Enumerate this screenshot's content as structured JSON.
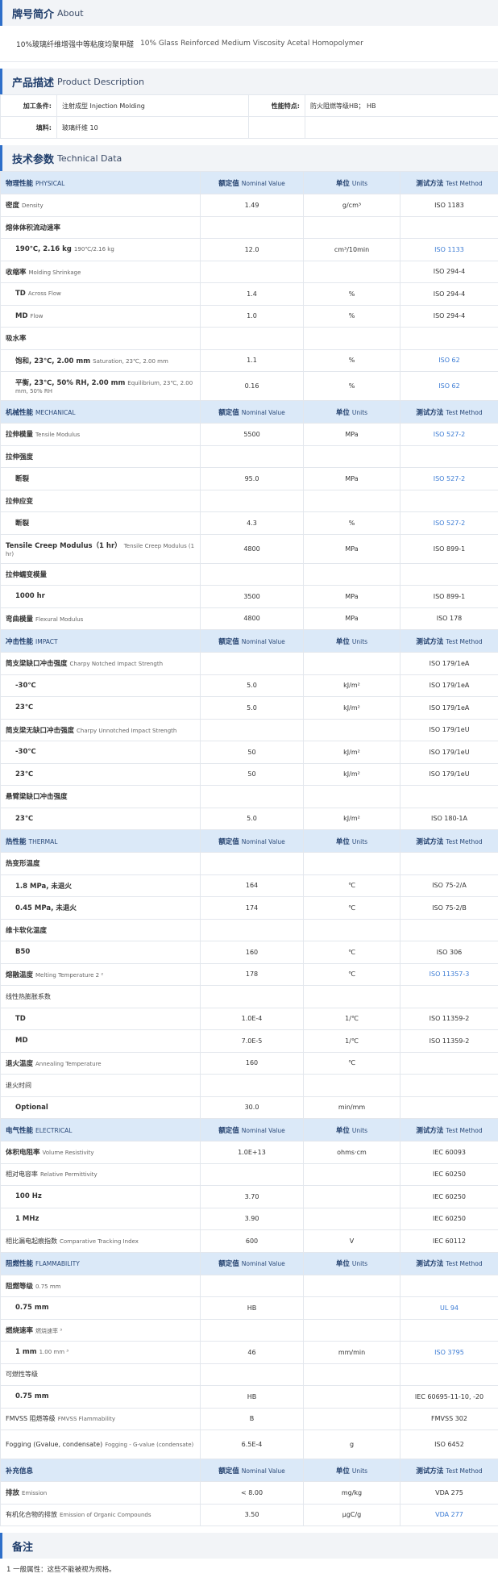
{
  "about": {
    "title_zh": "牌号简介",
    "title_en": "About",
    "text_zh": "10%玻璃纤维增强中等粘度均聚甲醛",
    "text_en": "10% Glass Reinforced Medium Viscosity Acetal Homopolymer"
  },
  "product": {
    "title_zh": "产品描述",
    "title_en": "Product Description",
    "rows": [
      {
        "label1": "加工条件:",
        "value1": "注射成型 Injection Molding",
        "label2": "性能特点:",
        "value2": "防火阻燃等级HB； HB"
      },
      {
        "label1": "填料:",
        "value1": "玻璃纤维 10",
        "label2": "",
        "value2": ""
      }
    ]
  },
  "tech": {
    "title_zh": "技术参数",
    "title_en": "Technical Data",
    "header_labels": {
      "nominal_zh": "额定值",
      "nominal_en": "Nominal Value",
      "units_zh": "单位",
      "units_en": "Units",
      "method_zh": "测试方法",
      "method_en": "Test Method"
    },
    "rows": [
      {
        "type": "hdr",
        "zh": "物理性能",
        "en": "PHYSICAL"
      },
      {
        "zh": "密度",
        "en": "Density",
        "value": "1.49",
        "unit": "g/cm³",
        "method": "ISO 1183"
      },
      {
        "zh": "熔体体积流动速率",
        "en": "熔体体积流动速率",
        "value": "",
        "unit": "",
        "method": ""
      },
      {
        "zh": "190℃, 2.16 kg",
        "en": "190℃/2.16 kg",
        "value": "12.0",
        "unit": "cm³/10min",
        "method": "ISO 1133",
        "ind": true,
        "link": true
      },
      {
        "zh": "收缩率",
        "en": "Molding Shrinkage",
        "value": "",
        "unit": "",
        "method": "ISO 294-4"
      },
      {
        "zh": "TD",
        "en": "Across Flow",
        "value": "1.4",
        "unit": "%",
        "method": "ISO 294-4",
        "ind": true
      },
      {
        "zh": "MD",
        "en": "Flow",
        "value": "1.0",
        "unit": "%",
        "method": "ISO 294-4",
        "ind": true
      },
      {
        "zh": "吸水率",
        "en": "吸水率",
        "value": "",
        "unit": "",
        "method": ""
      },
      {
        "zh": "饱和, 23℃, 2.00 mm",
        "en": "Saturation, 23℃, 2.00 mm",
        "value": "1.1",
        "unit": "%",
        "method": "ISO 62",
        "ind": true,
        "link": true
      },
      {
        "zh": "平衡, 23℃, 50% RH, 2.00 mm",
        "en": "Equilibrium, 23℃, 2.00 mm, 50% RH",
        "value": "0.16",
        "unit": "%",
        "method": "ISO 62",
        "ind": true,
        "link": true,
        "tall": true
      },
      {
        "type": "hdr",
        "zh": "机械性能",
        "en": "MECHANICAL"
      },
      {
        "zh": "拉伸模量",
        "en": "Tensile Modulus",
        "value": "5500",
        "unit": "MPa",
        "method": "ISO 527-2",
        "link": true
      },
      {
        "zh": "拉伸强度",
        "en": "拉伸强度",
        "value": "",
        "unit": "",
        "method": ""
      },
      {
        "zh": "断裂",
        "en": "断裂",
        "value": "95.0",
        "unit": "MPa",
        "method": "ISO 527-2",
        "ind": true,
        "link": true
      },
      {
        "zh": "拉伸应变",
        "en": "拉伸应变",
        "value": "",
        "unit": "",
        "method": ""
      },
      {
        "zh": "断裂",
        "en": "断裂",
        "value": "4.3",
        "unit": "%",
        "method": "ISO 527-2",
        "ind": true,
        "link": true
      },
      {
        "zh": "Tensile Creep Modulus（1 hr）",
        "en": "Tensile Creep Modulus (1 hr)",
        "value": "4800",
        "unit": "MPa",
        "method": "ISO 899-1",
        "tall": true
      },
      {
        "zh": "拉伸蠕变模量",
        "en": "拉伸蠕变模量",
        "value": "",
        "unit": "",
        "method": ""
      },
      {
        "zh": "1000 hr",
        "en": "1000 hr",
        "value": "3500",
        "unit": "MPa",
        "method": "ISO 899-1",
        "ind": true
      },
      {
        "zh": "弯曲模量",
        "en": "Flexural Modulus",
        "value": "4800",
        "unit": "MPa",
        "method": "ISO 178"
      },
      {
        "type": "hdr",
        "zh": "冲击性能",
        "en": "IMPACT"
      },
      {
        "zh": "简支梁缺口冲击强度",
        "en": "Charpy Notched Impact Strength",
        "value": "",
        "unit": "",
        "method": "ISO 179/1eA"
      },
      {
        "zh": "-30℃",
        "en": "-30℃",
        "value": "5.0",
        "unit": "kJ/m²",
        "method": "ISO 179/1eA",
        "ind": true
      },
      {
        "zh": "23℃",
        "en": "23℃",
        "value": "5.0",
        "unit": "kJ/m²",
        "method": "ISO 179/1eA",
        "ind": true
      },
      {
        "zh": "简支梁无缺口冲击强度",
        "en": "Charpy Unnotched Impact Strength",
        "value": "",
        "unit": "",
        "method": "ISO 179/1eU"
      },
      {
        "zh": "-30℃",
        "en": "-30℃",
        "value": "50",
        "unit": "kJ/m²",
        "method": "ISO 179/1eU",
        "ind": true
      },
      {
        "zh": "23℃",
        "en": "23℃",
        "value": "50",
        "unit": "kJ/m²",
        "method": "ISO 179/1eU",
        "ind": true
      },
      {
        "zh": "悬臂梁缺口冲击强度",
        "en": "悬臂梁缺口冲击强度",
        "value": "",
        "unit": "",
        "method": ""
      },
      {
        "zh": "23℃",
        "en": "23℃",
        "value": "5.0",
        "unit": "kJ/m²",
        "method": "ISO 180-1A",
        "ind": true
      },
      {
        "type": "hdr",
        "zh": "热性能",
        "en": "THERMAL"
      },
      {
        "zh": "热变形温度",
        "en": "热变形温度",
        "value": "",
        "unit": "",
        "method": ""
      },
      {
        "zh": "1.8 MPa, 未退火",
        "en": "1.8 MPa, 未退火",
        "value": "164",
        "unit": "℃",
        "method": "ISO 75-2/A",
        "ind": true
      },
      {
        "zh": "0.45 MPa, 未退火",
        "en": "0.45 MPa, 未退火",
        "value": "174",
        "unit": "℃",
        "method": "ISO 75-2/B",
        "ind": true
      },
      {
        "zh": "维卡软化温度",
        "en": "维卡软化温度",
        "value": "",
        "unit": "",
        "method": ""
      },
      {
        "zh": "B50",
        "en": "B50",
        "value": "160",
        "unit": "℃",
        "method": "ISO 306",
        "ind": true
      },
      {
        "zh": "熔融温度",
        "en": "Melting Temperature 2 ²",
        "value": "178",
        "unit": "℃",
        "method": "ISO 11357-3",
        "link": true
      },
      {
        "zh": "线性热膨胀系数",
        "en": "线性热膨胀系数",
        "value": "",
        "unit": "",
        "method": "",
        "plain": true
      },
      {
        "zh": "TD",
        "en": "TD",
        "value": "1.0E-4",
        "unit": "1/℃",
        "method": "ISO 11359-2",
        "ind": true
      },
      {
        "zh": "MD",
        "en": "MD",
        "value": "7.0E-5",
        "unit": "1/℃",
        "method": "ISO 11359-2",
        "ind": true
      },
      {
        "zh": "退火温度",
        "en": "Annealing Temperature",
        "value": "160",
        "unit": "℃",
        "method": ""
      },
      {
        "zh": "退火时间",
        "en": "退火时间",
        "value": "",
        "unit": "",
        "method": "",
        "plain": true
      },
      {
        "zh": "Optional",
        "en": "Optional",
        "value": "30.0",
        "unit": "min/mm",
        "method": "",
        "ind": true
      },
      {
        "type": "hdr",
        "zh": "电气性能",
        "en": "ELECTRICAL"
      },
      {
        "zh": "体积电阻率",
        "en": "Volume Resistivity",
        "value": "1.0E+13",
        "unit": "ohms·cm",
        "method": "IEC 60093"
      },
      {
        "zh": "相对电容率",
        "en": "Relative Permittivity",
        "value": "",
        "unit": "",
        "method": "IEC 60250",
        "plain": true
      },
      {
        "zh": "100 Hz",
        "en": "100 Hz",
        "value": "3.70",
        "unit": "",
        "method": "IEC 60250",
        "ind": true
      },
      {
        "zh": "1 MHz",
        "en": "1 MHz",
        "value": "3.90",
        "unit": "",
        "method": "IEC 60250",
        "ind": true
      },
      {
        "zh": "相比漏电起痕指数",
        "en": "Comparative Tracking Index",
        "value": "600",
        "unit": "V",
        "method": "IEC 60112",
        "plain": true
      },
      {
        "type": "hdr",
        "zh": "阻燃性能",
        "en": "FLAMMABILITY"
      },
      {
        "zh": "阻燃等级",
        "en": "0.75 mm",
        "value": "",
        "unit": "",
        "method": ""
      },
      {
        "zh": "0.75 mm",
        "en": "",
        "value": "HB",
        "unit": "",
        "method": "UL 94",
        "ind": true,
        "link": true
      },
      {
        "zh": "燃烧速率",
        "en": "燃烧速率 ³",
        "value": "",
        "unit": "",
        "method": ""
      },
      {
        "zh": "1 mm",
        "en": "1.00 mm ³",
        "value": "46",
        "unit": "mm/min",
        "method": "ISO 3795",
        "ind": true,
        "link": true
      },
      {
        "zh": "可燃性等级",
        "en": "可燃性等级",
        "value": "",
        "unit": "",
        "method": "",
        "plain": true
      },
      {
        "zh": "0.75 mm",
        "en": "0.75 mm",
        "value": "HB",
        "unit": "",
        "method": "IEC 60695-11-10, -20",
        "ind": true
      },
      {
        "zh": "FMVSS 阻燃等级",
        "en": "FMVSS Flammability",
        "value": "B",
        "unit": "",
        "method": "FMVSS 302",
        "plain": true
      },
      {
        "zh": "Fogging (Gvalue, condensate)",
        "en": "Fogging - G-value (condensate)",
        "value": "6.5E-4",
        "unit": "g",
        "method": "ISO 6452",
        "tall": true,
        "plain": true
      },
      {
        "type": "hdr",
        "zh": "补充信息",
        "en": ""
      },
      {
        "zh": "排放",
        "en": "Emission",
        "value": "< 8.00",
        "unit": "mg/kg",
        "method": "VDA 275"
      },
      {
        "zh": "有机化合物的排放",
        "en": "Emission of Organic Compounds",
        "value": "3.50",
        "unit": "µgC/g",
        "method": "VDA 277",
        "link": true,
        "plain": true
      }
    ]
  },
  "notes": {
    "title_zh": "备注",
    "line1": "1 一般属性：这些不能被视为规格。"
  }
}
